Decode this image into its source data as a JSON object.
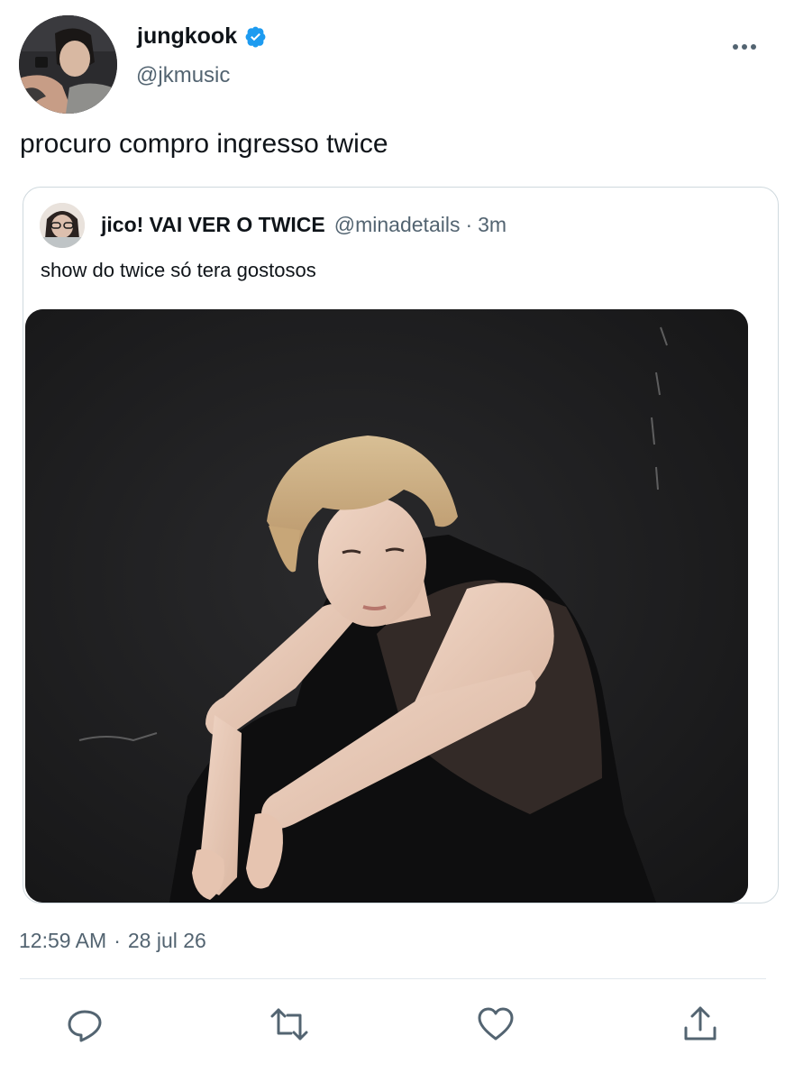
{
  "tweet": {
    "author": {
      "name": "jungkook",
      "handle": "@jkmusic",
      "verified": true,
      "avatar": "person-avatar"
    },
    "text": "procuro compro ingresso twice",
    "timestamp": {
      "time": "12:59 AM",
      "separator": "·",
      "date": "28 jul 26"
    }
  },
  "quoted_tweet": {
    "name": "jico! VAI VER O TWICE",
    "handle": "@minadetails",
    "separator": "·",
    "time": "3m",
    "text": "show do twice só tera gostosos",
    "media": "photo-person-black-background"
  },
  "actions": [
    "reply-icon",
    "retweet-icon",
    "like-icon",
    "share-icon"
  ],
  "colors": {
    "primary_text": "#0f1419",
    "secondary_text": "#536471",
    "verified_blue": "#1d9bf0",
    "border": "#cfd9de",
    "action_icon": "#536471"
  }
}
